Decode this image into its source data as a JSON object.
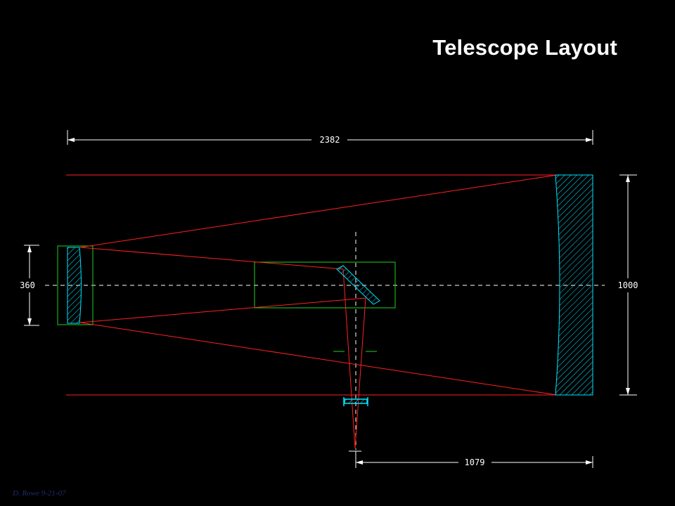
{
  "title": "Telescope Layout",
  "author": "D. Rowe 9-21-07",
  "dimensions": {
    "overall_length": "2382",
    "primary_aperture": "1000",
    "secondary_diameter": "360",
    "focus_offset": "1079"
  },
  "colors": {
    "background": "#000000",
    "rays": "#ff2020",
    "mirror_outline": "#00e5ff",
    "baffle": "#20d020",
    "dimension": "#ffffff"
  }
}
